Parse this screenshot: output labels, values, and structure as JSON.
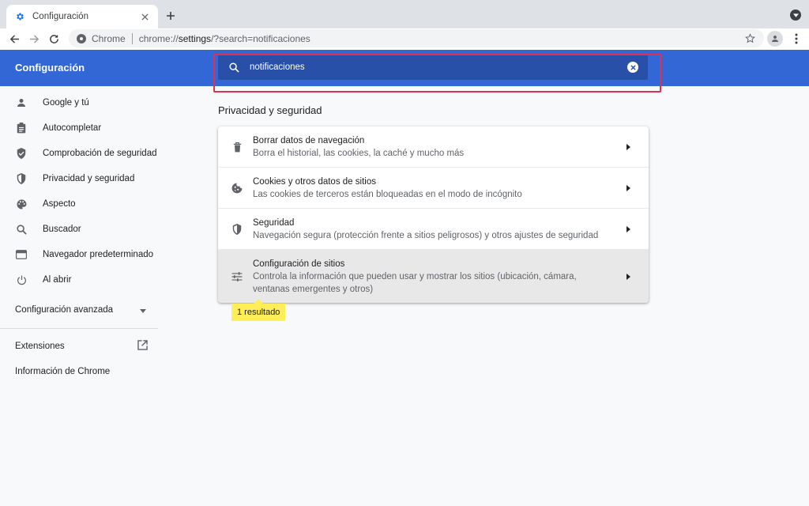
{
  "browser": {
    "tab_title": "Configuración",
    "omnibox": {
      "site_label": "Chrome",
      "url_prefix": "chrome://",
      "url_host": "settings",
      "url_rest": "/?search=notificaciones"
    }
  },
  "header": {
    "title": "Configuración",
    "search_value": "notificaciones"
  },
  "sidebar": {
    "items": [
      {
        "label": "Google y tú",
        "icon": "person-icon"
      },
      {
        "label": "Autocompletar",
        "icon": "clipboard-icon"
      },
      {
        "label": "Comprobación de seguridad",
        "icon": "shield-check-icon"
      },
      {
        "label": "Privacidad y seguridad",
        "icon": "shield-half-icon"
      },
      {
        "label": "Aspecto",
        "icon": "palette-icon"
      },
      {
        "label": "Buscador",
        "icon": "search-icon"
      },
      {
        "label": "Navegador predeterminado",
        "icon": "browser-window-icon"
      },
      {
        "label": "Al abrir",
        "icon": "power-icon"
      }
    ],
    "advanced_label": "Configuración avanzada",
    "extensions_label": "Extensiones",
    "about_label": "Información de Chrome"
  },
  "main": {
    "section_title": "Privacidad y seguridad",
    "rows": [
      {
        "title": "Borrar datos de navegación",
        "subtitle": "Borra el historial, las cookies, la caché y mucho más",
        "icon": "trash-icon"
      },
      {
        "title": "Cookies y otros datos de sitios",
        "subtitle": "Las cookies de terceros están bloqueadas en el modo de incógnito",
        "icon": "cookie-icon"
      },
      {
        "title": "Seguridad",
        "subtitle": "Navegación segura (protección frente a sitios peligrosos) y otros ajustes de seguridad",
        "icon": "shield-half-icon"
      },
      {
        "title": "Configuración de sitios",
        "subtitle": "Controla la información que pueden usar y mostrar los sitios (ubicación, cámara, ventanas emergentes y otros)",
        "icon": "sliders-icon"
      }
    ],
    "result_tooltip": "1 resultado"
  },
  "colors": {
    "header_blue": "#3367d6",
    "search_bg": "#2850a8",
    "highlight_border": "#e0304f",
    "tooltip_yellow": "#ffee58"
  }
}
